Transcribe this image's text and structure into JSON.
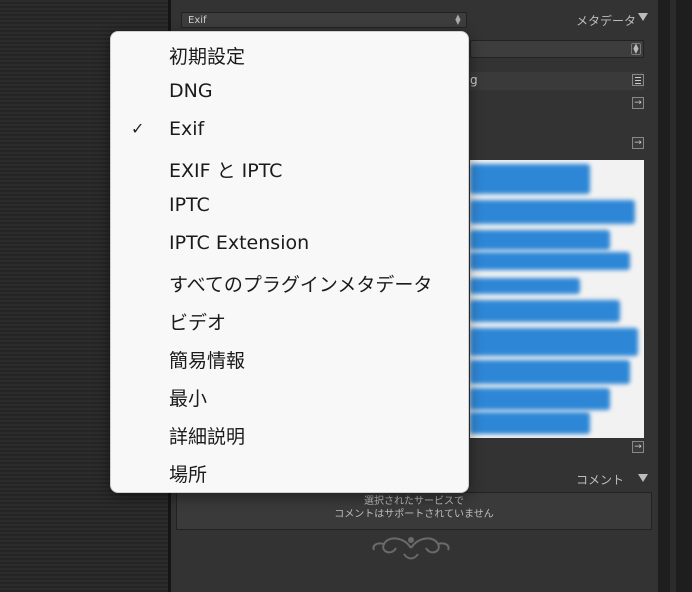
{
  "metadata_panel": {
    "preset_value": "Exif",
    "section_title": "メタデータ",
    "field_fragment": "g"
  },
  "preset_menu": {
    "items": [
      {
        "label": "初期設定",
        "checked": false
      },
      {
        "label": "DNG",
        "checked": false
      },
      {
        "label": "Exif",
        "checked": true
      },
      {
        "label": "EXIF と IPTC",
        "checked": false
      },
      {
        "label": "IPTC",
        "checked": false
      },
      {
        "label": "IPTC Extension",
        "checked": false
      },
      {
        "label": "すべてのプラグインメタデータ",
        "checked": false
      },
      {
        "label": "ビデオ",
        "checked": false
      },
      {
        "label": "簡易情報",
        "checked": false
      },
      {
        "label": "最小",
        "checked": false
      },
      {
        "label": "詳細説明",
        "checked": false
      },
      {
        "label": "場所",
        "checked": false
      }
    ],
    "check_glyph": "✓"
  },
  "comments_panel": {
    "title": "コメント",
    "message_line1": "選択されたサービスで",
    "message_line2": "コメントはサポートされていません"
  },
  "colors": {
    "menu_bg": "#f8f8f8",
    "panel_bg": "#333333",
    "thumb_blue": "#2e87d6"
  }
}
